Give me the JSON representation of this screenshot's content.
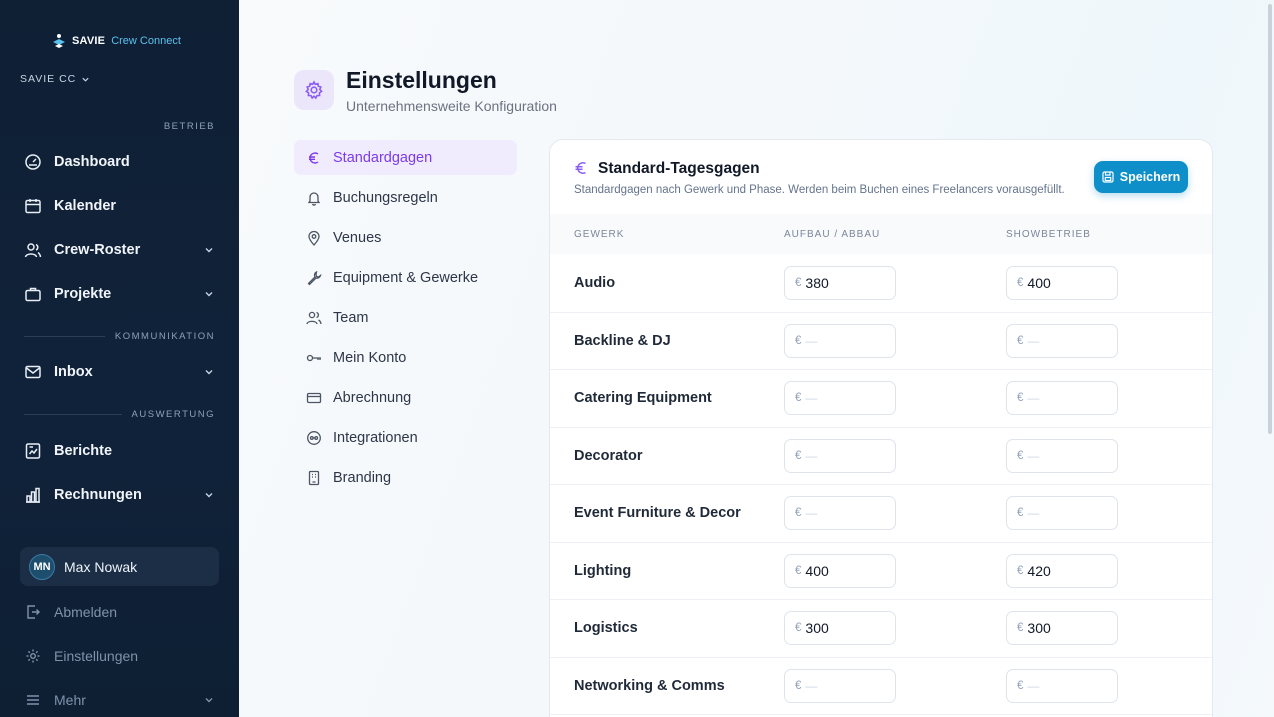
{
  "brand": {
    "name_bold": "SAVIE",
    "name_light": "Crew Connect"
  },
  "org": {
    "label": "SAVIE CC"
  },
  "sidebar": {
    "sections": {
      "betrieb": "BETRIEB",
      "kommunikation": "KOMMUNIKATION",
      "auswertung": "AUSWERTUNG"
    },
    "items": [
      {
        "label": "Dashboard",
        "icon": "dashboard-icon",
        "has_chevron": false
      },
      {
        "label": "Kalender",
        "icon": "calendar-icon",
        "has_chevron": false
      },
      {
        "label": "Crew-Roster",
        "icon": "users-icon",
        "has_chevron": true
      },
      {
        "label": "Projekte",
        "icon": "briefcase-icon",
        "has_chevron": true
      },
      {
        "label": "Inbox",
        "icon": "mail-icon",
        "has_chevron": true
      },
      {
        "label": "Berichte",
        "icon": "report-icon",
        "has_chevron": false
      },
      {
        "label": "Rechnungen",
        "icon": "bar-chart-icon",
        "has_chevron": true
      }
    ],
    "user": {
      "initials": "MN",
      "name": "Max Nowak"
    },
    "footer": {
      "logout": "Abmelden",
      "settings": "Einstellungen",
      "more": "Mehr"
    }
  },
  "page": {
    "title": "Einstellungen",
    "subtitle": "Unternehmensweite Konfiguration"
  },
  "settings_nav": [
    {
      "label": "Standardgagen",
      "icon": "euro-icon",
      "active": true
    },
    {
      "label": "Buchungsregeln",
      "icon": "bell-icon",
      "active": false
    },
    {
      "label": "Venues",
      "icon": "map-pin-icon",
      "active": false
    },
    {
      "label": "Equipment & Gewerke",
      "icon": "wrench-icon",
      "active": false
    },
    {
      "label": "Team",
      "icon": "users-icon",
      "active": false
    },
    {
      "label": "Mein Konto",
      "icon": "key-icon",
      "active": false
    },
    {
      "label": "Abrechnung",
      "icon": "credit-card-icon",
      "active": false
    },
    {
      "label": "Integrationen",
      "icon": "link-icon",
      "active": false
    },
    {
      "label": "Branding",
      "icon": "building-icon",
      "active": false
    }
  ],
  "card": {
    "title": "Standard-Tagesgagen",
    "description": "Standardgagen nach Gewerk und Phase. Werden beim Buchen eines Freelancers vorausgefüllt.",
    "save_label": "Speichern",
    "columns": {
      "gewerk": "GEWERK",
      "aufbau": "AUFBAU / ABBAU",
      "show": "SHOWBETRIEB"
    },
    "currency": "€",
    "empty_placeholder": "—",
    "rows": [
      {
        "gewerk": "Audio",
        "aufbau": "380",
        "show": "400"
      },
      {
        "gewerk": "Backline & DJ",
        "aufbau": "",
        "show": ""
      },
      {
        "gewerk": "Catering Equipment",
        "aufbau": "",
        "show": ""
      },
      {
        "gewerk": "Decorator",
        "aufbau": "",
        "show": ""
      },
      {
        "gewerk": "Event Furniture & Decor",
        "aufbau": "",
        "show": ""
      },
      {
        "gewerk": "Lighting",
        "aufbau": "400",
        "show": "420"
      },
      {
        "gewerk": "Logistics",
        "aufbau": "300",
        "show": "300"
      },
      {
        "gewerk": "Networking & Comms",
        "aufbau": "",
        "show": ""
      }
    ]
  },
  "colors": {
    "accent": "#7c3aed",
    "primary_button": "#0e8fc9",
    "sidebar_bg": "#0f2035"
  }
}
